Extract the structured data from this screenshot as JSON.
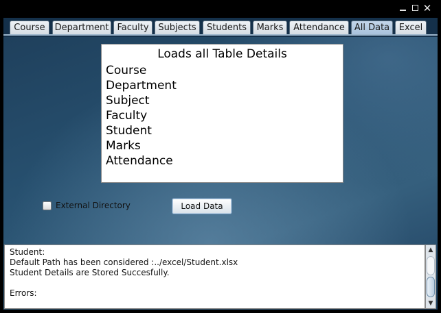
{
  "window": {
    "minimize_glyph": "",
    "close_glyph": "✕"
  },
  "tabs": [
    {
      "label": "Course"
    },
    {
      "label": "Department"
    },
    {
      "label": "Faculty"
    },
    {
      "label": "Subjects"
    },
    {
      "label": "Students"
    },
    {
      "label": "Marks"
    },
    {
      "label": "Attendance"
    },
    {
      "label": "All Data",
      "selected": true
    },
    {
      "label": "Excel"
    }
  ],
  "tables_box": {
    "title": "Loads all Table Details",
    "items": [
      "Course",
      "Department",
      "Subject",
      "Faculty",
      "Student",
      "Marks",
      "Attendance"
    ]
  },
  "options": {
    "external_directory_label": "External Directory",
    "external_directory_checked": false,
    "load_button_label": "Load Data"
  },
  "log": {
    "lines": [
      "Student:",
      "Default Path has been considered :../excel/Student.xlsx",
      "Student Details are Stored Succesfully.",
      "",
      "Errors:"
    ]
  },
  "colors": {
    "selected_tab": "#b3c9e0",
    "background": "#2a5272"
  }
}
